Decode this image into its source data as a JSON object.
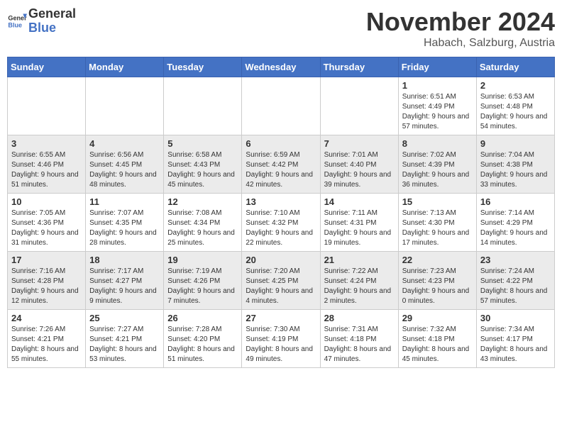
{
  "header": {
    "logo_line1": "General",
    "logo_line2": "Blue",
    "month": "November 2024",
    "location": "Habach, Salzburg, Austria"
  },
  "columns": [
    "Sunday",
    "Monday",
    "Tuesday",
    "Wednesday",
    "Thursday",
    "Friday",
    "Saturday"
  ],
  "weeks": [
    [
      {
        "day": "",
        "info": ""
      },
      {
        "day": "",
        "info": ""
      },
      {
        "day": "",
        "info": ""
      },
      {
        "day": "",
        "info": ""
      },
      {
        "day": "",
        "info": ""
      },
      {
        "day": "1",
        "info": "Sunrise: 6:51 AM\nSunset: 4:49 PM\nDaylight: 9 hours and 57 minutes."
      },
      {
        "day": "2",
        "info": "Sunrise: 6:53 AM\nSunset: 4:48 PM\nDaylight: 9 hours and 54 minutes."
      }
    ],
    [
      {
        "day": "3",
        "info": "Sunrise: 6:55 AM\nSunset: 4:46 PM\nDaylight: 9 hours and 51 minutes."
      },
      {
        "day": "4",
        "info": "Sunrise: 6:56 AM\nSunset: 4:45 PM\nDaylight: 9 hours and 48 minutes."
      },
      {
        "day": "5",
        "info": "Sunrise: 6:58 AM\nSunset: 4:43 PM\nDaylight: 9 hours and 45 minutes."
      },
      {
        "day": "6",
        "info": "Sunrise: 6:59 AM\nSunset: 4:42 PM\nDaylight: 9 hours and 42 minutes."
      },
      {
        "day": "7",
        "info": "Sunrise: 7:01 AM\nSunset: 4:40 PM\nDaylight: 9 hours and 39 minutes."
      },
      {
        "day": "8",
        "info": "Sunrise: 7:02 AM\nSunset: 4:39 PM\nDaylight: 9 hours and 36 minutes."
      },
      {
        "day": "9",
        "info": "Sunrise: 7:04 AM\nSunset: 4:38 PM\nDaylight: 9 hours and 33 minutes."
      }
    ],
    [
      {
        "day": "10",
        "info": "Sunrise: 7:05 AM\nSunset: 4:36 PM\nDaylight: 9 hours and 31 minutes."
      },
      {
        "day": "11",
        "info": "Sunrise: 7:07 AM\nSunset: 4:35 PM\nDaylight: 9 hours and 28 minutes."
      },
      {
        "day": "12",
        "info": "Sunrise: 7:08 AM\nSunset: 4:34 PM\nDaylight: 9 hours and 25 minutes."
      },
      {
        "day": "13",
        "info": "Sunrise: 7:10 AM\nSunset: 4:32 PM\nDaylight: 9 hours and 22 minutes."
      },
      {
        "day": "14",
        "info": "Sunrise: 7:11 AM\nSunset: 4:31 PM\nDaylight: 9 hours and 19 minutes."
      },
      {
        "day": "15",
        "info": "Sunrise: 7:13 AM\nSunset: 4:30 PM\nDaylight: 9 hours and 17 minutes."
      },
      {
        "day": "16",
        "info": "Sunrise: 7:14 AM\nSunset: 4:29 PM\nDaylight: 9 hours and 14 minutes."
      }
    ],
    [
      {
        "day": "17",
        "info": "Sunrise: 7:16 AM\nSunset: 4:28 PM\nDaylight: 9 hours and 12 minutes."
      },
      {
        "day": "18",
        "info": "Sunrise: 7:17 AM\nSunset: 4:27 PM\nDaylight: 9 hours and 9 minutes."
      },
      {
        "day": "19",
        "info": "Sunrise: 7:19 AM\nSunset: 4:26 PM\nDaylight: 9 hours and 7 minutes."
      },
      {
        "day": "20",
        "info": "Sunrise: 7:20 AM\nSunset: 4:25 PM\nDaylight: 9 hours and 4 minutes."
      },
      {
        "day": "21",
        "info": "Sunrise: 7:22 AM\nSunset: 4:24 PM\nDaylight: 9 hours and 2 minutes."
      },
      {
        "day": "22",
        "info": "Sunrise: 7:23 AM\nSunset: 4:23 PM\nDaylight: 9 hours and 0 minutes."
      },
      {
        "day": "23",
        "info": "Sunrise: 7:24 AM\nSunset: 4:22 PM\nDaylight: 8 hours and 57 minutes."
      }
    ],
    [
      {
        "day": "24",
        "info": "Sunrise: 7:26 AM\nSunset: 4:21 PM\nDaylight: 8 hours and 55 minutes."
      },
      {
        "day": "25",
        "info": "Sunrise: 7:27 AM\nSunset: 4:21 PM\nDaylight: 8 hours and 53 minutes."
      },
      {
        "day": "26",
        "info": "Sunrise: 7:28 AM\nSunset: 4:20 PM\nDaylight: 8 hours and 51 minutes."
      },
      {
        "day": "27",
        "info": "Sunrise: 7:30 AM\nSunset: 4:19 PM\nDaylight: 8 hours and 49 minutes."
      },
      {
        "day": "28",
        "info": "Sunrise: 7:31 AM\nSunset: 4:18 PM\nDaylight: 8 hours and 47 minutes."
      },
      {
        "day": "29",
        "info": "Sunrise: 7:32 AM\nSunset: 4:18 PM\nDaylight: 8 hours and 45 minutes."
      },
      {
        "day": "30",
        "info": "Sunrise: 7:34 AM\nSunset: 4:17 PM\nDaylight: 8 hours and 43 minutes."
      }
    ]
  ]
}
